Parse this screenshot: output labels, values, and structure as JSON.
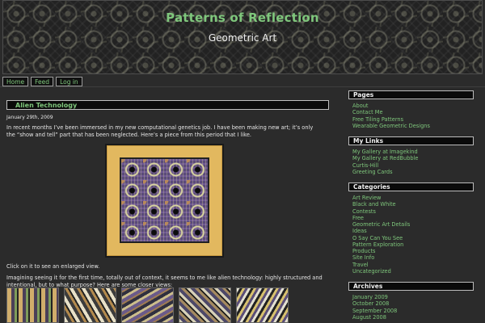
{
  "header": {
    "site_title": "Patterns of Reflection",
    "site_subtitle": "Geometric Art"
  },
  "nav": {
    "items": [
      "Home",
      "Feed",
      "Log in"
    ]
  },
  "post": {
    "title": "Alien Technology",
    "date": "January 29th, 2009",
    "intro": "In recent months I’ve been immersed in my new computational genetics job. I have been making new art; it’s only the “show and tell” part that has been neglected. Here’s a piece from this period that I like.",
    "click_text": "Click on it to see an enlarged view.",
    "imagining_text": "Imagining seeing it for the first time, totally out of context, it seems to me like alien technology: highly structured and intentional, but to what purpose? Here are some closer views:"
  },
  "sidebar": {
    "pages": {
      "title": "Pages",
      "items": [
        "About",
        "Contact Me",
        "Free Tiling Patterns",
        "Wearable Geometric Designs"
      ]
    },
    "links": {
      "title": "My Links",
      "items": [
        "My Gallery at Imagekind",
        "My Gallery at RedBubble",
        "Curtis-Hill",
        "Greeting Cards"
      ]
    },
    "categories": {
      "title": "Categories",
      "items": [
        "Art Review",
        "Black and White",
        "Contests",
        "Free",
        "Geometric Art Details",
        "Ideas",
        "O Say Can You See",
        "Pattern Exploration",
        "Products",
        "Site Info",
        "Travel",
        "Uncategorized"
      ]
    },
    "archives": {
      "title": "Archives",
      "items": [
        "January 2009",
        "October 2008",
        "September 2008",
        "August 2008"
      ]
    }
  },
  "colors": {
    "background": "#2b2b2b",
    "accent_green": "#7fc77c",
    "frame_gold": "#e2b85f"
  }
}
